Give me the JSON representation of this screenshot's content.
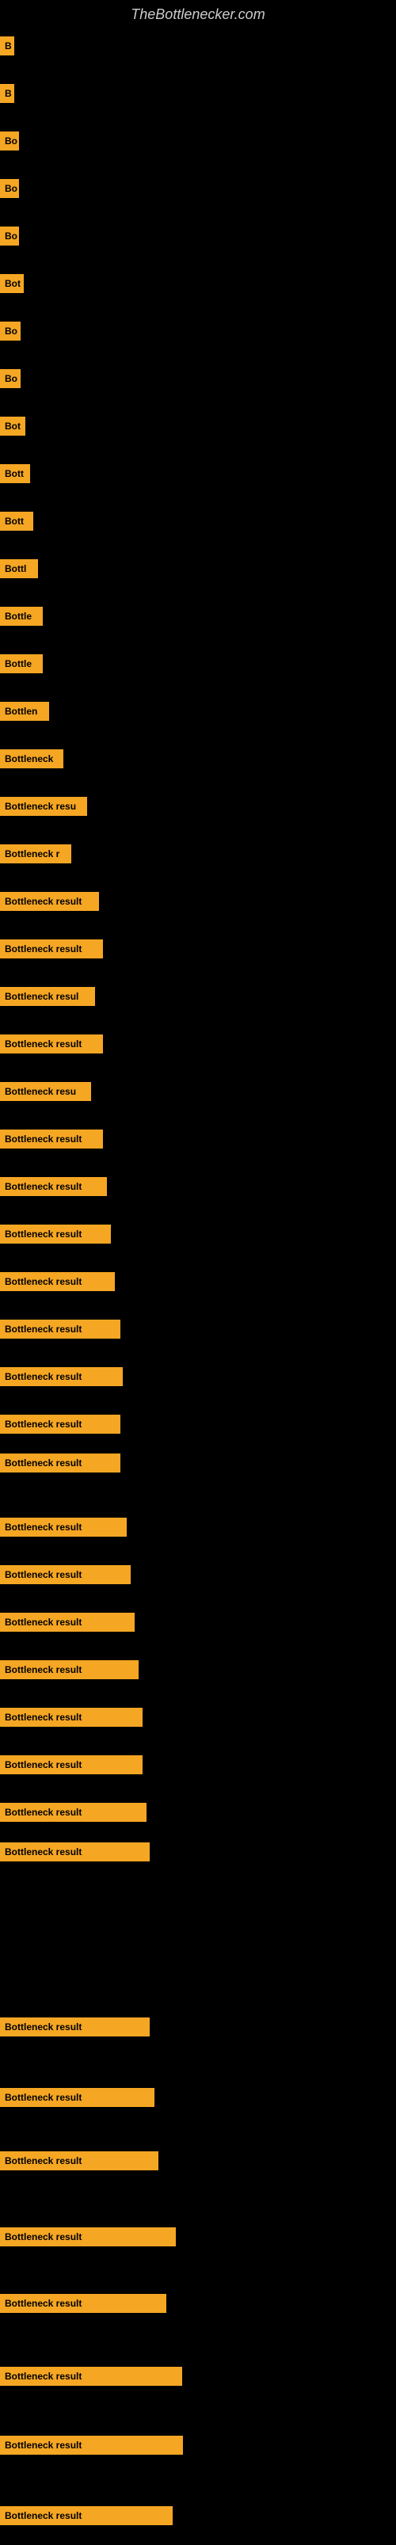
{
  "site": {
    "title": "TheBottlenecker.com"
  },
  "items": [
    {
      "label": "B",
      "labelWidth": 18,
      "topOffset": 30
    },
    {
      "label": "B",
      "labelWidth": 18,
      "topOffset": 90
    },
    {
      "label": "Bo",
      "labelWidth": 24,
      "topOffset": 150
    },
    {
      "label": "Bo",
      "labelWidth": 24,
      "topOffset": 210
    },
    {
      "label": "Bo",
      "labelWidth": 24,
      "topOffset": 270
    },
    {
      "label": "Bot",
      "labelWidth": 30,
      "topOffset": 330
    },
    {
      "label": "Bo",
      "labelWidth": 26,
      "topOffset": 390
    },
    {
      "label": "Bo",
      "labelWidth": 26,
      "topOffset": 450
    },
    {
      "label": "Bot",
      "labelWidth": 32,
      "topOffset": 510
    },
    {
      "label": "Bott",
      "labelWidth": 38,
      "topOffset": 570
    },
    {
      "label": "Bott",
      "labelWidth": 42,
      "topOffset": 630
    },
    {
      "label": "Bottl",
      "labelWidth": 48,
      "topOffset": 690
    },
    {
      "label": "Bottle",
      "labelWidth": 54,
      "topOffset": 750
    },
    {
      "label": "Bottle",
      "labelWidth": 54,
      "topOffset": 810
    },
    {
      "label": "Bottlen",
      "labelWidth": 62,
      "topOffset": 870
    },
    {
      "label": "Bottleneck",
      "labelWidth": 80,
      "topOffset": 930
    },
    {
      "label": "Bottleneck resu",
      "labelWidth": 110,
      "topOffset": 990
    },
    {
      "label": "Bottleneck r",
      "labelWidth": 90,
      "topOffset": 1050
    },
    {
      "label": "Bottleneck result",
      "labelWidth": 125,
      "topOffset": 1110
    },
    {
      "label": "Bottleneck result",
      "labelWidth": 130,
      "topOffset": 1170
    },
    {
      "label": "Bottleneck resul",
      "labelWidth": 120,
      "topOffset": 1230
    },
    {
      "label": "Bottleneck result",
      "labelWidth": 130,
      "topOffset": 1290
    },
    {
      "label": "Bottleneck resu",
      "labelWidth": 115,
      "topOffset": 1350
    },
    {
      "label": "Bottleneck result",
      "labelWidth": 130,
      "topOffset": 1410
    },
    {
      "label": "Bottleneck result",
      "labelWidth": 135,
      "topOffset": 1470
    },
    {
      "label": "Bottleneck result",
      "labelWidth": 140,
      "topOffset": 1530
    },
    {
      "label": "Bottleneck result",
      "labelWidth": 145,
      "topOffset": 1590
    },
    {
      "label": "Bottleneck result",
      "labelWidth": 152,
      "topOffset": 1650
    },
    {
      "label": "Bottleneck result",
      "labelWidth": 155,
      "topOffset": 1710
    },
    {
      "label": "Bottleneck result",
      "labelWidth": 152,
      "topOffset": 1770
    },
    {
      "label": "Bottleneck result",
      "labelWidth": 152,
      "topOffset": 1819
    },
    {
      "label": "Bottleneck result",
      "labelWidth": 160,
      "topOffset": 1900
    },
    {
      "label": "Bottleneck result",
      "labelWidth": 165,
      "topOffset": 1960
    },
    {
      "label": "Bottleneck result",
      "labelWidth": 170,
      "topOffset": 2020
    },
    {
      "label": "Bottleneck result",
      "labelWidth": 175,
      "topOffset": 2080
    },
    {
      "label": "Bottleneck result",
      "labelWidth": 180,
      "topOffset": 2140
    },
    {
      "label": "Bottleneck result",
      "labelWidth": 180,
      "topOffset": 2200
    },
    {
      "label": "Bottleneck result",
      "labelWidth": 185,
      "topOffset": 2260
    },
    {
      "label": "Bottleneck result",
      "labelWidth": 189,
      "topOffset": 2310
    },
    {
      "label": "Bottleneck result",
      "labelWidth": 189,
      "topOffset": 2531
    },
    {
      "label": "Bottleneck result",
      "labelWidth": 195,
      "topOffset": 2620
    },
    {
      "label": "Bottleneck result",
      "labelWidth": 200,
      "topOffset": 2700
    },
    {
      "label": "Bottleneck result",
      "labelWidth": 222,
      "topOffset": 2796
    },
    {
      "label": "Bottleneck result",
      "labelWidth": 210,
      "topOffset": 2880
    },
    {
      "label": "Bottleneck result",
      "labelWidth": 230,
      "topOffset": 2972
    },
    {
      "label": "Bottleneck result",
      "labelWidth": 231,
      "topOffset": 3059
    },
    {
      "label": "Bottleneck result",
      "labelWidth": 218,
      "topOffset": 3148
    }
  ]
}
